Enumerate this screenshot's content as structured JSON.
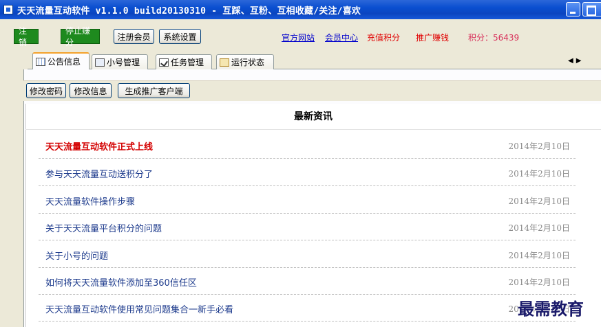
{
  "window": {
    "title": "天天流量互动软件 v1.1.0 build20130310 - 互踩、互粉、互相收藏/关注/喜欢"
  },
  "toolbar": {
    "logout_label": "注销",
    "stop_earning_label": "停止赚分",
    "register_label": "注册会员",
    "settings_label": "系统设置",
    "official_site": "官方网站",
    "member_center": "会员中心",
    "recharge_points": "充值积分",
    "promote_earn": "推广赚钱",
    "points_label": "积分：",
    "points_value": "56439"
  },
  "tabs": [
    {
      "label": "公告信息",
      "icon": "grid-icon",
      "active": true
    },
    {
      "label": "小号管理",
      "icon": "card-icon",
      "active": false
    },
    {
      "label": "任务管理",
      "icon": "task-icon",
      "active": false
    },
    {
      "label": "运行状态",
      "icon": "status-icon",
      "active": false
    }
  ],
  "sub_buttons": {
    "change_password": "修改密码",
    "change_info": "修改信息",
    "generate_client": "生成推广客户端"
  },
  "news": {
    "header": "最新资讯",
    "items": [
      {
        "title": "天天流量互动软件正式上线",
        "date": "2014年2月10日"
      },
      {
        "title": "参与天天流量互动送积分了",
        "date": "2014年2月10日"
      },
      {
        "title": "天天流量软件操作步骤",
        "date": "2014年2月10日"
      },
      {
        "title": "关于天天流量平台积分的问题",
        "date": "2014年2月10日"
      },
      {
        "title": "关于小号的问题",
        "date": "2014年2月10日"
      },
      {
        "title": "如何将天天流量软件添加至360信任区",
        "date": "2014年2月10日"
      },
      {
        "title": "天天流量互动软件使用常见问题集合一新手必看",
        "date": "2014年2月10日"
      }
    ]
  },
  "watermark": "最需教育",
  "colors": {
    "titlebar": "#0a4fd0",
    "green_button": "#1e8a1e",
    "hot_news": "#d40000",
    "news_link": "#1c3a8c"
  }
}
